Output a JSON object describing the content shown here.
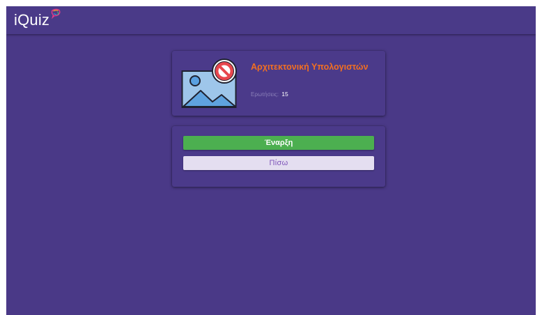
{
  "header": {
    "logo_text": "iQuiz",
    "logo_icon": "speech-bubble-logo-icon"
  },
  "quiz": {
    "title": "Αρχιτεκτονική Υπολογιστών",
    "questions_label": "Ερωτήσεις:",
    "questions_count": "15",
    "image_icon": "image-unavailable-icon"
  },
  "actions": {
    "start_label": "Έναρξη",
    "back_label": "Πίσω"
  },
  "colors": {
    "background": "#4a3987",
    "title": "#f26f21",
    "start_button": "#4caf50",
    "back_button": "#e4def0",
    "back_text": "#7c52b8"
  }
}
